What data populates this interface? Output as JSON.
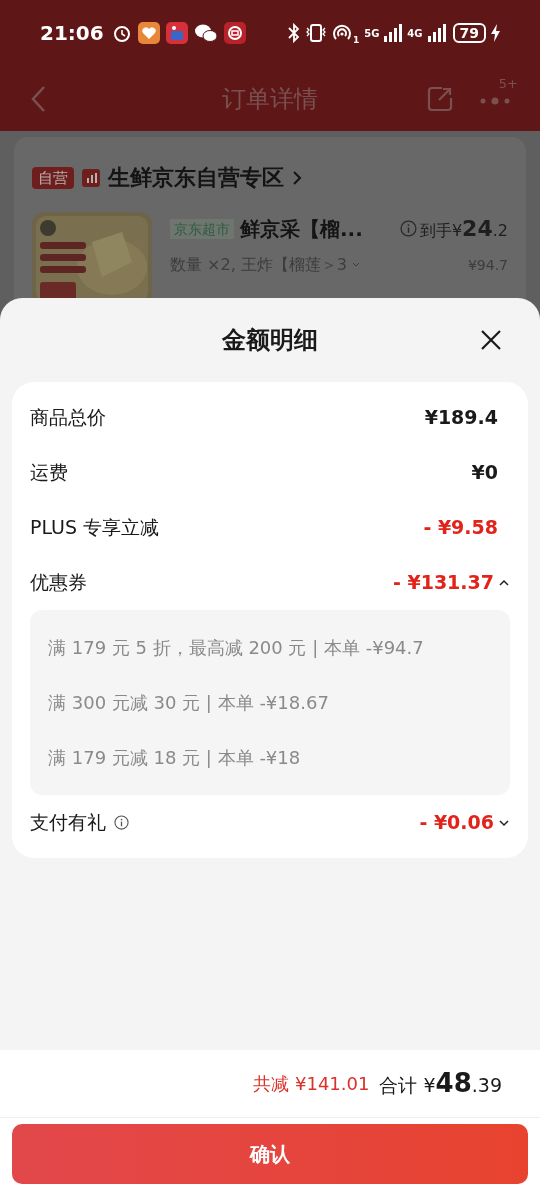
{
  "status_bar": {
    "time": "21:06",
    "sim_mark": "1",
    "net_1": "5G",
    "net_2": "4G",
    "battery": "79"
  },
  "header": {
    "title": "订单详情",
    "badge": "5+"
  },
  "store": {
    "tag": "自营",
    "name": "生鲜京东自营专区"
  },
  "product": {
    "channel_tag": "京东超市",
    "name": "鲜京采【榴...",
    "spec": "数量 ×2, 王炸【榴莲＞3",
    "price_prefix": "到手¥",
    "price_int": "24",
    "price_dec": ".2",
    "original_price": "¥94.7"
  },
  "sheet": {
    "title": "金额明细",
    "rows": [
      {
        "kind": "plain",
        "label": "商品总价",
        "value": "¥189.4"
      },
      {
        "kind": "plain",
        "label": "运费",
        "value": "¥0"
      },
      {
        "kind": "discount",
        "label": "PLUS 专享立减",
        "value": "- ¥9.58"
      },
      {
        "kind": "discount",
        "label": "优惠券",
        "value": "- ¥131.37",
        "expanded": true,
        "details": [
          "满 179 元 5 折，最高减 200 元 | 本单 -¥94.7",
          "满 300 元减 30 元 | 本单 -¥18.67",
          "满 179 元减 18 元 | 本单 -¥18"
        ]
      },
      {
        "kind": "discount",
        "label": "支付有礼",
        "value": "- ¥0.06",
        "info": true,
        "expanded": false
      }
    ]
  },
  "footer": {
    "savings_label": "共减",
    "savings": "¥141.01",
    "total_label": "合计",
    "total_currency": "¥",
    "total_int": "48",
    "total_dec": ".39",
    "confirm": "确认"
  }
}
